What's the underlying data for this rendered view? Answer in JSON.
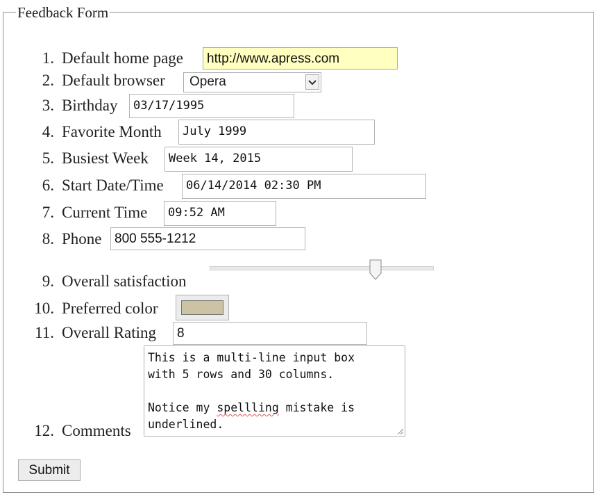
{
  "form": {
    "legend": "Feedback Form",
    "items": [
      {
        "num": "1.",
        "label": "Default home page",
        "value": "http://www.apress.com"
      },
      {
        "num": "2.",
        "label": "Default browser",
        "value": "Opera"
      },
      {
        "num": "3.",
        "label": "Birthday",
        "value": "03/17/1995"
      },
      {
        "num": "4.",
        "label": "Favorite Month",
        "value": "July 1999"
      },
      {
        "num": "5.",
        "label": "Busiest Week",
        "value": "Week 14, 2015"
      },
      {
        "num": "6.",
        "label": "Start Date/Time",
        "value": "06/14/2014 02:30 PM"
      },
      {
        "num": "7.",
        "label": "Current Time",
        "value": "09:52 AM"
      },
      {
        "num": "8.",
        "label": "Phone",
        "value": "800 555-1212"
      },
      {
        "num": "9.",
        "label": "Overall satisfaction",
        "value_fraction": 0.74
      },
      {
        "num": "10.",
        "label": "Preferred color",
        "color": "#cbc3a3"
      },
      {
        "num": "11.",
        "label": "Overall Rating",
        "value": "8"
      },
      {
        "num": "12.",
        "label": "Comments"
      }
    ],
    "comments": {
      "line1": "This is a multi-line input box",
      "line2": "with 5 rows and 30 columns.",
      "line3": "",
      "line4_before": "Notice my ",
      "line4_misspelled": "spellling",
      "line4_after": " mistake is",
      "line5": "underlined."
    },
    "submit_label": "Submit"
  },
  "colors": {
    "home_page_field_bg": "#ffffc0",
    "spellcheck_underline": "#d9534f",
    "border": "#8f8f8f"
  }
}
